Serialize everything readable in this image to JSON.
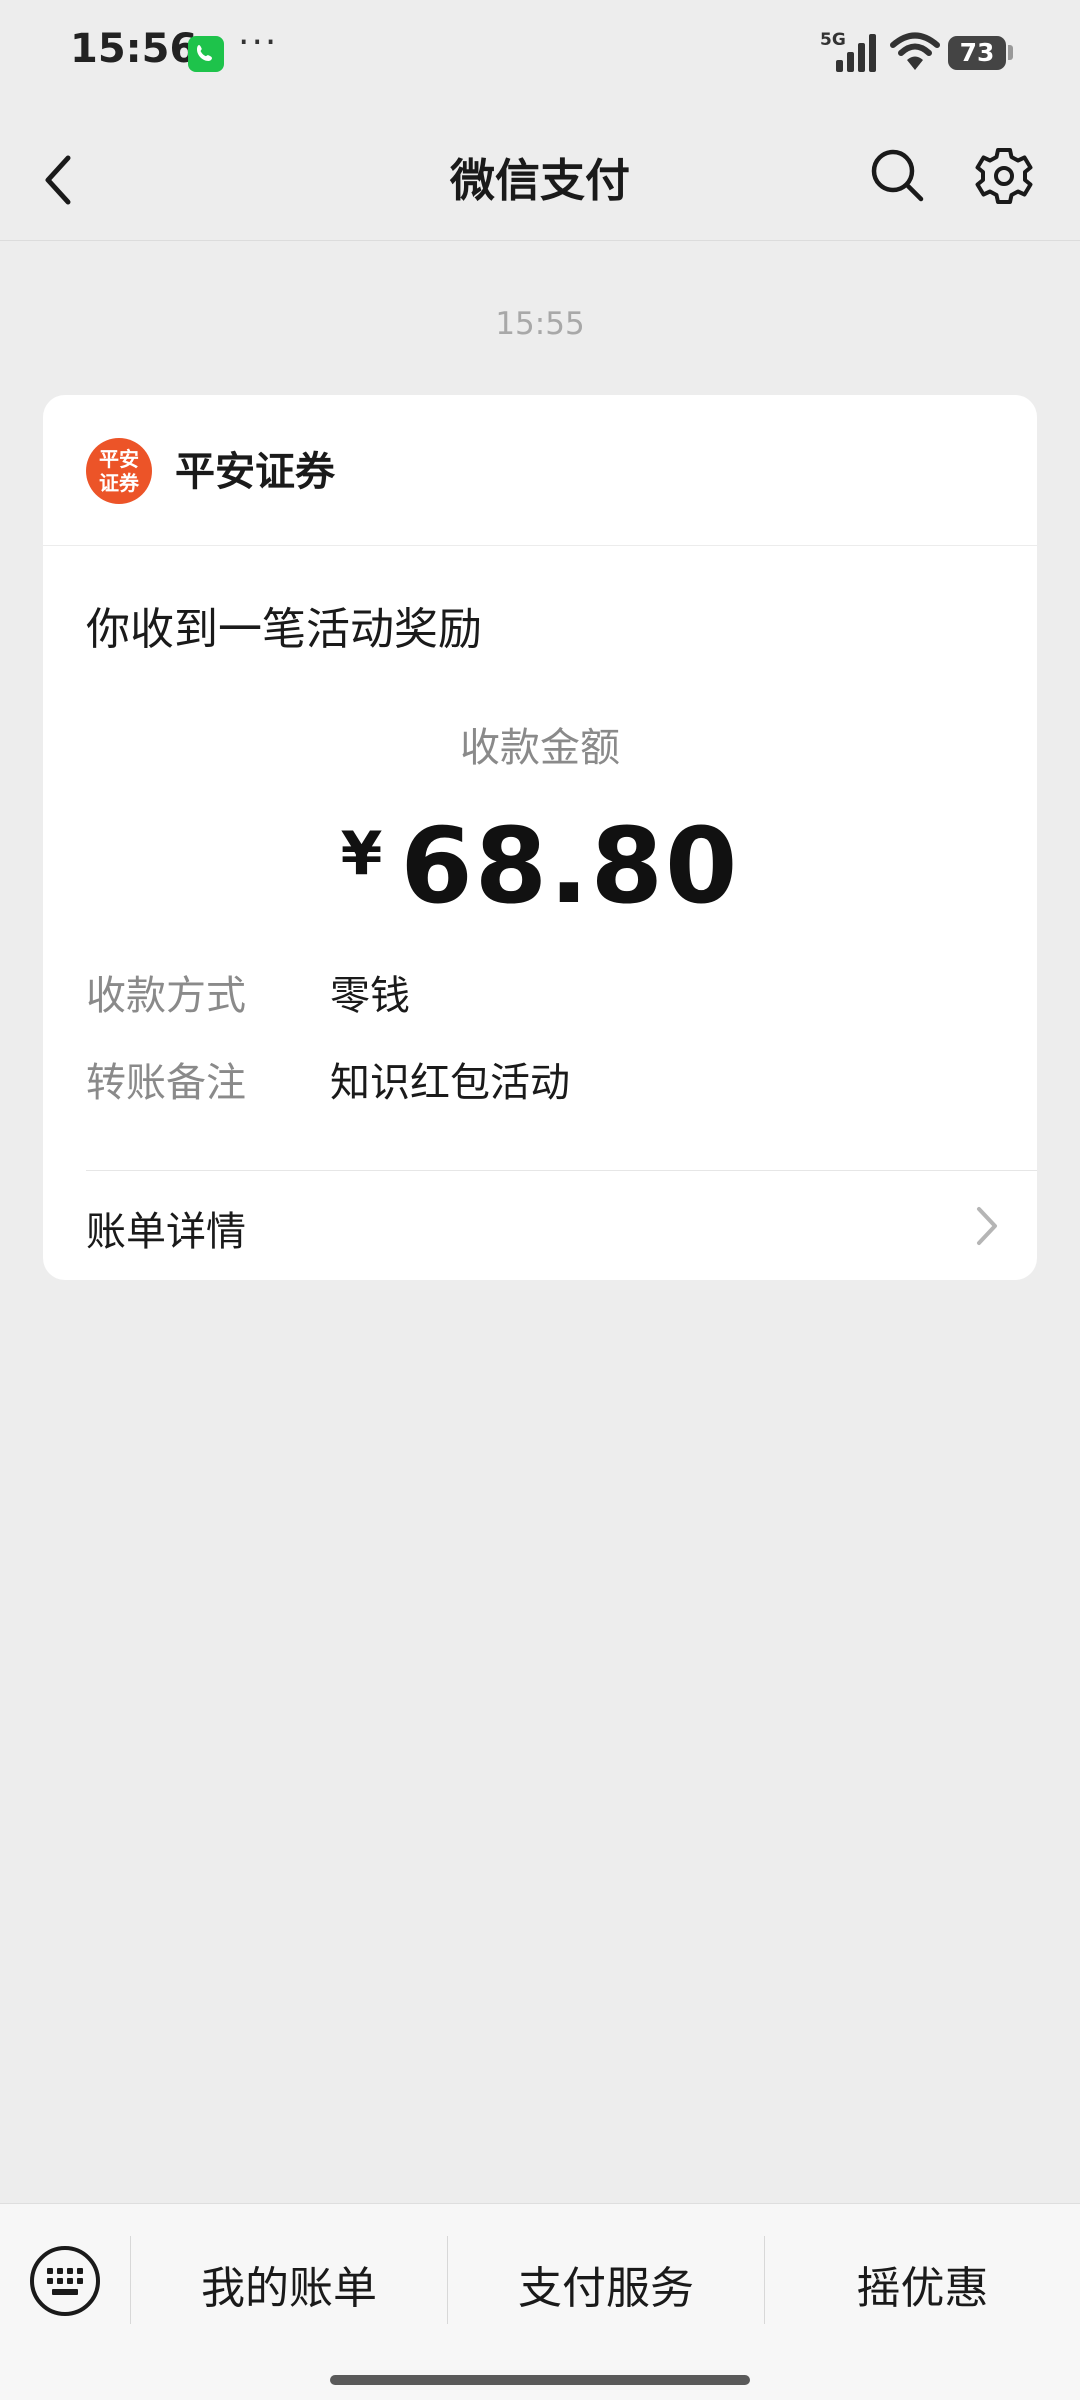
{
  "status_bar": {
    "time": "15:56",
    "dots": "···",
    "network": "5G",
    "battery": "73"
  },
  "nav": {
    "title": "微信支付"
  },
  "message_time": "15:55",
  "card": {
    "logo_text_line1": "平安",
    "logo_text_line2": "证券",
    "org_name": "平安证券",
    "subject": "你收到一笔活动奖励",
    "amount_label": "收款金额",
    "currency": "¥",
    "amount": "68.80",
    "rows": [
      {
        "label": "收款方式",
        "value": "零钱"
      },
      {
        "label": "转账备注",
        "value": "知识红包活动"
      }
    ],
    "detail_label": "账单详情"
  },
  "bottom_bar": {
    "items": [
      {
        "label": "我的账单"
      },
      {
        "label": "支付服务"
      },
      {
        "label": "摇优惠"
      }
    ]
  },
  "colors": {
    "background": "#ededed",
    "logo": "#ec5428",
    "call_indicator": "#1ec34b"
  }
}
